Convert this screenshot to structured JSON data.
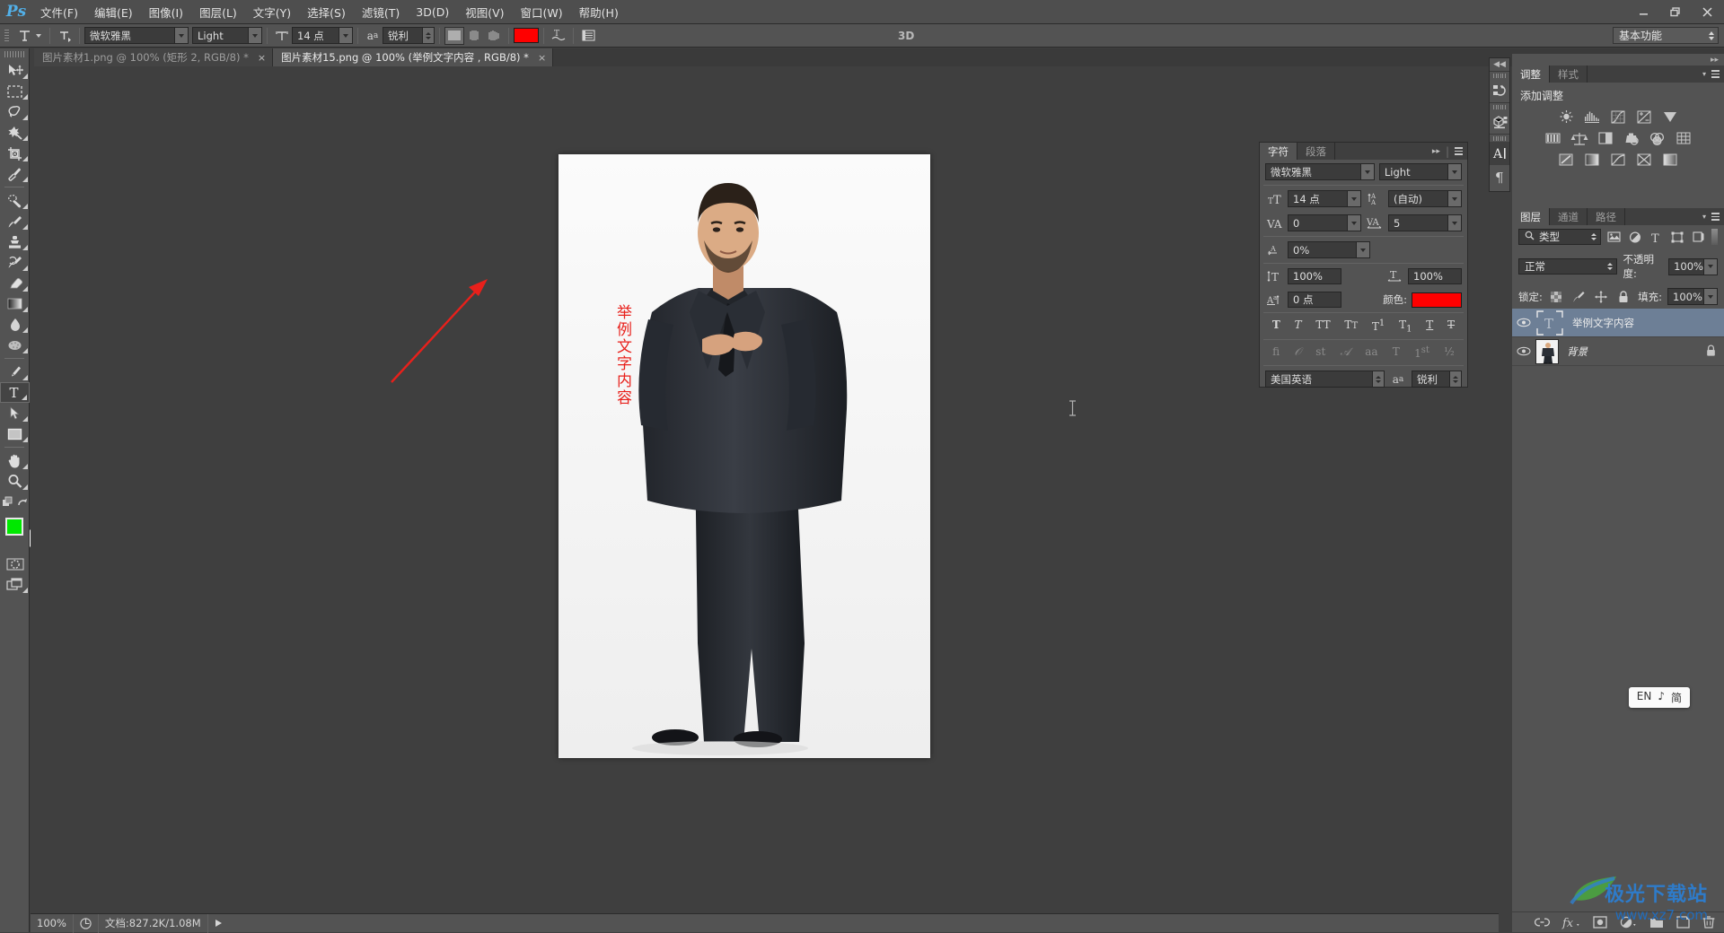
{
  "app": {
    "name": "Ps",
    "logo_color": "#52b0e8"
  },
  "menubar": {
    "items": [
      {
        "label": "文件(F)"
      },
      {
        "label": "编辑(E)"
      },
      {
        "label": "图像(I)"
      },
      {
        "label": "图层(L)"
      },
      {
        "label": "文字(Y)"
      },
      {
        "label": "选择(S)"
      },
      {
        "label": "滤镜(T)"
      },
      {
        "label": "3D(D)"
      },
      {
        "label": "视图(V)"
      },
      {
        "label": "窗口(W)"
      },
      {
        "label": "帮助(H)"
      }
    ],
    "window_controls": [
      "minimize",
      "restore",
      "close"
    ]
  },
  "options_bar": {
    "tool_icon": "type-tool-icon",
    "orientation_icon": "text-orientation-icon",
    "font_family": "微软雅黑",
    "font_style": "Light",
    "font_size": "14 点",
    "anti_alias_icon": "aa-icon",
    "anti_alias": "锐利",
    "align": [
      "align-left",
      "align-center",
      "align-right"
    ],
    "align_selected": 0,
    "color": "#ff0000",
    "warp_icon": "warp-text-icon",
    "panels_icon": "toggle-panels-icon",
    "three_d_label": "3D",
    "workspace": "基本功能"
  },
  "tabs": [
    {
      "label": "图片素材1.png @ 100% (矩形 2, RGB/8) *",
      "active": false,
      "close": "×"
    },
    {
      "label": "图片素材15.png @ 100% (举例文字内容 , RGB/8) *",
      "active": true,
      "close": "×"
    }
  ],
  "toolbar": {
    "tools": [
      {
        "name": "move-tool",
        "selected": false
      },
      {
        "name": "rectangular-marquee-tool",
        "selected": false
      },
      {
        "name": "lasso-tool",
        "selected": false
      },
      {
        "name": "magic-wand-tool",
        "selected": false
      },
      {
        "name": "crop-tool",
        "selected": false
      },
      {
        "name": "eyedropper-tool",
        "selected": false
      },
      {
        "name": "spot-healing-brush-tool",
        "selected": false
      },
      {
        "name": "brush-tool",
        "selected": false
      },
      {
        "name": "clone-stamp-tool",
        "selected": false
      },
      {
        "name": "history-brush-tool",
        "selected": false
      },
      {
        "name": "eraser-tool",
        "selected": false
      },
      {
        "name": "gradient-tool",
        "selected": false
      },
      {
        "name": "blur-tool",
        "selected": false
      },
      {
        "name": "dodge-tool",
        "selected": false
      },
      {
        "name": "pen-tool",
        "selected": false
      },
      {
        "name": "horizontal-type-tool",
        "selected": true
      },
      {
        "name": "path-selection-tool",
        "selected": false
      },
      {
        "name": "rectangle-tool",
        "selected": false
      },
      {
        "name": "hand-tool",
        "selected": false
      },
      {
        "name": "zoom-tool",
        "selected": false
      }
    ],
    "foreground_color": "#00e800",
    "background_color": "#ffffff",
    "quick_mask_icon": "quick-mask-icon",
    "screen-mode-icon": "screen-mode-icon"
  },
  "canvas": {
    "text_layer_content": "举例文字内容",
    "text_color": "#e8201b",
    "arrow_color": "#e8201b",
    "cursor_icon": "text-insert-cursor"
  },
  "icon_strip": {
    "collapse_icon": "collapse-panels-icon",
    "items": [
      {
        "name": "history-panel-icon",
        "selected": false
      },
      {
        "name": "3d-panel-icon",
        "selected": false
      },
      {
        "name": "character-panel-icon",
        "selected": true
      },
      {
        "name": "paragraph-panel-icon",
        "selected": false
      }
    ]
  },
  "character_panel": {
    "tabs": [
      {
        "label": "字符",
        "active": true
      },
      {
        "label": "段落",
        "active": false
      }
    ],
    "collapse_icon": "expand-arrows-icon",
    "menu_icon": "panel-menu-icon",
    "font_family": "微软雅黑",
    "font_style": "Light",
    "size_icon": "font-size-icon",
    "font_size": "14 点",
    "leading_icon": "leading-icon",
    "leading": "(自动)",
    "kerning_icon": "kerning-icon",
    "kerning": "0",
    "tracking_icon": "tracking-icon",
    "tracking": "5",
    "vertical_scale_icon": "vertical-scale-icon",
    "vertical_scale": "100%",
    "horizontal_scale_icon": "horizontal-scale-icon",
    "horizontal_scale": "100%",
    "baseline_icon": "baseline-shift-icon",
    "baseline_shift": "0 点",
    "color_label": "颜色:",
    "color": "#ff0000",
    "t_scale_icon": "scale-icon",
    "t_scale": "0%",
    "style_buttons": [
      "T",
      "T",
      "TT",
      "Tᴛ",
      "T¹",
      "T₁",
      "T",
      "T"
    ],
    "opentype_buttons": [
      "fi",
      "𝒪",
      "st",
      "𝒜",
      "aa",
      "T",
      "1st",
      "½"
    ],
    "language": "美国英语",
    "aa_icon": "anti-alias-icon",
    "anti_alias": "锐利"
  },
  "adjustments_panel": {
    "tabs": [
      {
        "label": "调整",
        "active": true
      },
      {
        "label": "样式",
        "active": false
      }
    ],
    "title": "添加调整",
    "menu_icon": "panel-menu-icon",
    "row1": [
      "brightness-contrast-icon",
      "levels-icon",
      "curves-icon",
      "exposure-icon",
      "vibrance-icon"
    ],
    "row2": [
      "hue-saturation-icon",
      "color-balance-icon",
      "black-white-icon",
      "photo-filter-icon",
      "channel-mixer-icon",
      "color-lookup-icon"
    ],
    "row3": [
      "invert-icon",
      "posterize-icon",
      "threshold-icon",
      "gradient-map-icon",
      "selective-color-icon"
    ]
  },
  "layers_panel": {
    "tabs": [
      {
        "label": "图层",
        "active": true
      },
      {
        "label": "通道",
        "active": false
      },
      {
        "label": "路径",
        "active": false
      }
    ],
    "menu_icon": "panel-menu-icon",
    "filter_label": "类型",
    "filter_icons": [
      "filter-pixel-icon",
      "filter-adjustment-icon",
      "filter-type-icon",
      "filter-shape-icon",
      "filter-smart-icon"
    ],
    "blend_mode": "正常",
    "opacity_label": "不透明度:",
    "opacity": "100%",
    "lock_label": "锁定:",
    "lock_icons": [
      "lock-transparency-icon",
      "lock-image-icon",
      "lock-position-icon",
      "lock-all-icon"
    ],
    "fill_label": "填充:",
    "fill": "100%",
    "layers": [
      {
        "name": "举例文字内容",
        "type": "text",
        "visible": true,
        "selected": true,
        "locked": false
      },
      {
        "name": "背景",
        "type": "image",
        "visible": true,
        "selected": false,
        "locked": true
      }
    ],
    "bottom_buttons": [
      "link-layers-icon",
      "fx-icon",
      "add-mask-icon",
      "new-adjustment-icon",
      "new-group-icon",
      "new-layer-icon",
      "delete-layer-icon"
    ]
  },
  "status_bar": {
    "zoom": "100%",
    "doc_icon": "doc-preview-icon",
    "doc_info": "文档:827.2K/1.08M",
    "expand_icon": "play-arrow-icon"
  },
  "ime": {
    "lang": "EN",
    "mode_icon": "♪",
    "shape": "简"
  },
  "watermark": {
    "line1": "极光下载站",
    "line2": "www.xz7.com"
  }
}
